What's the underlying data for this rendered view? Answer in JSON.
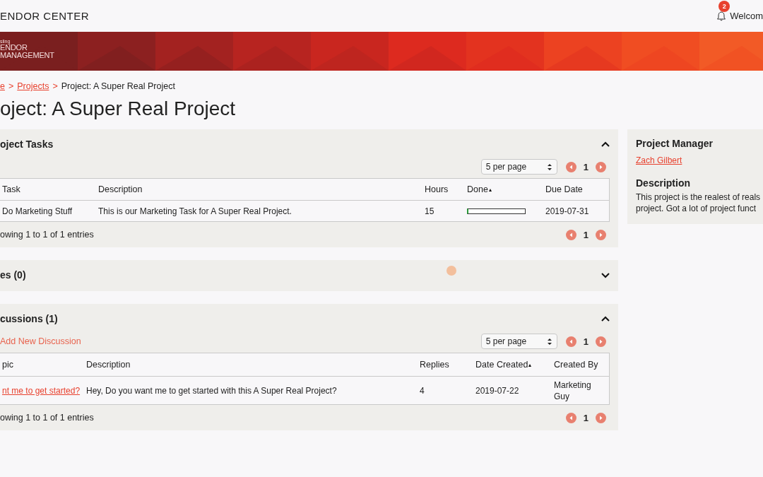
{
  "header": {
    "title": "ENDOR CENTER",
    "notifications": "2",
    "welcome": "Welcom"
  },
  "banner": {
    "brand_small": "sling",
    "brand_line1": "ENDOR",
    "brand_line2": "MANAGEMENT"
  },
  "breadcrumb": [
    {
      "label": "e",
      "link": true
    },
    {
      "separator": ">",
      "label": "Projects",
      "link": true
    },
    {
      "separator": ">",
      "label": "Project: A Super Real Project",
      "link": false
    }
  ],
  "page_title": "oject: A Super Real Project",
  "sections": [
    {
      "kind": "tasks",
      "title": "oject Tasks",
      "expanded": true,
      "per_page": "5 per page",
      "page": "1",
      "footer": "owing 1 to 1 of 1 entries",
      "footer_page": "1",
      "columns": [
        {
          "label": "Task",
          "sorted": false
        },
        {
          "label": "Description",
          "sorted": false
        },
        {
          "label": "Hours",
          "sorted": false
        },
        {
          "label": "Done",
          "sorted": true
        },
        {
          "label": "Due Date",
          "sorted": false
        }
      ],
      "rows": [
        {
          "task": "Do Marketing Stuff",
          "description": "This is our Marketing Task for A Super Real Project.",
          "hours": "15",
          "level": 0,
          "due": "2019-07-31"
        }
      ]
    },
    {
      "kind": "files",
      "title": "es (0)",
      "expanded": false
    },
    {
      "kind": "discussions",
      "title": "cussions (1)",
      "expanded": true,
      "add": "Add New Discussion",
      "per_page": "5 per page",
      "page": "1",
      "footer": "owing 1 to 1 of 1 entries",
      "footer_page": "1",
      "columns": [
        {
          "label": "pic",
          "sorted": false
        },
        {
          "label": "Description",
          "sorted": false
        },
        {
          "label": "Replies",
          "sorted": false
        },
        {
          "label": "Date Created",
          "sorted": true
        },
        {
          "label": "Created By",
          "sorted": false
        }
      ],
      "rows": [
        {
          "topic": "nt me to get started?",
          "description": "Hey, Do you want me to get started with this A Super Real Project?",
          "replies": "4",
          "created": "2019-07-22",
          "created_by": "Marketing Guy"
        }
      ]
    }
  ],
  "side": {
    "manager_heading": "Project Manager",
    "manager": "Zach Gilbert",
    "description_heading": "Description",
    "description_lines": [
      "This project is the realest of reals",
      "project. Got a lot of project funct"
    ]
  }
}
